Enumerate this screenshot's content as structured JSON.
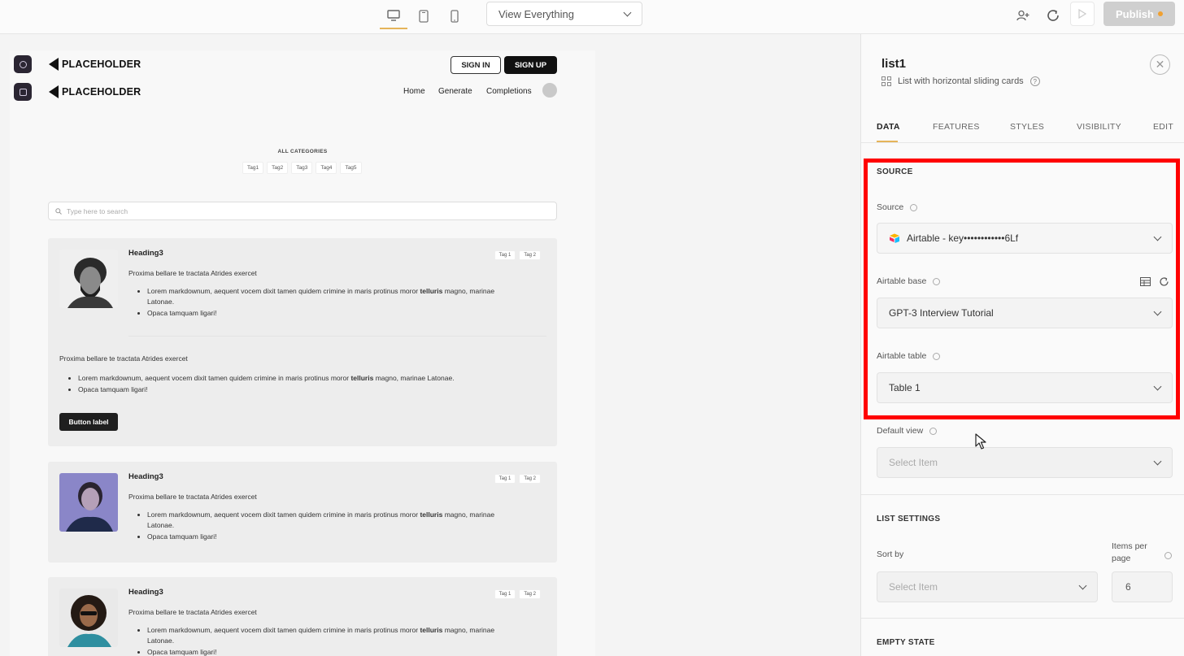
{
  "toolbar": {
    "view_select": "View Everything",
    "publish_label": "Publish"
  },
  "preview": {
    "logo_text": "PLACEHOLDER",
    "signin_label": "SIGN IN",
    "signup_label": "SIGN UP",
    "nav_links": [
      "Home",
      "Generate",
      "Completions"
    ],
    "categories_title": "ALL CATEGORIES",
    "category_tags": [
      "Tag1",
      "Tag2",
      "Tag3",
      "Tag4",
      "Tag5"
    ],
    "search_placeholder": "Type here to search",
    "cards": [
      {
        "heading": "Heading3",
        "tags": [
          "Tag 1",
          "Tag 2"
        ],
        "text": "Proxima bellare te tractata Atrides exercet",
        "list_1": "Lorem markdownum, aequent vocem dixit tamen quidem crimine in maris protinus moror",
        "list_1_bold": "telluris",
        "list_1_end": "magno, marinae Latonae.",
        "list_2": "Opaca tamquam ligari!",
        "extra_text": "Proxima bellare te tractata Atrides exercet",
        "extra_list_1": "Lorem markdownum, aequent vocem dixit tamen quidem crimine in maris protinus moror",
        "extra_list_1_bold": "telluris",
        "extra_list_1_end": "magno, marinae Latonae.",
        "extra_list_2": "Opaca tamquam ligari!",
        "button_label": "Button label"
      },
      {
        "heading": "Heading3",
        "tags": [
          "Tag 1",
          "Tag 2"
        ],
        "text": "Proxima bellare te tractata Atrides exercet",
        "list_1": "Lorem markdownum, aequent vocem dixit tamen quidem crimine in maris protinus moror",
        "list_1_bold": "telluris",
        "list_1_end": "magno, marinae Latonae.",
        "list_2": "Opaca tamquam ligari!"
      },
      {
        "heading": "Heading3",
        "tags": [
          "Tag 1",
          "Tag 2"
        ],
        "text": "Proxima bellare te tractata Atrides exercet",
        "list_1": "Lorem markdownum, aequent vocem dixit tamen quidem crimine in maris protinus moror",
        "list_1_bold": "telluris",
        "list_1_end": "magno, marinae Latonae.",
        "list_2": "Opaca tamquam ligari!"
      }
    ]
  },
  "panel": {
    "title": "list1",
    "subtitle": "List with horizontal sliding cards",
    "tabs": [
      "DATA",
      "FEATURES",
      "STYLES",
      "VISIBILITY",
      "EDIT"
    ],
    "active_tab": "DATA",
    "source_section": "SOURCE",
    "source_label": "Source",
    "source_value": "Airtable - key••••••••••••6Lf",
    "base_label": "Airtable base",
    "base_value": "GPT-3 Interview Tutorial",
    "table_label": "Airtable table",
    "table_value": "Table 1",
    "default_view_label": "Default view",
    "default_view_placeholder": "Select Item",
    "list_settings_section": "LIST SETTINGS",
    "sort_label": "Sort by",
    "sort_placeholder": "Select Item",
    "items_per_page_label_1": "Items per",
    "items_per_page_label_2": "page",
    "items_per_page_value": "6",
    "empty_state_section": "EMPTY STATE"
  },
  "colors": {
    "accent": "#e5b45a",
    "highlight": "#ff0000",
    "primary_dark": "#111111"
  }
}
